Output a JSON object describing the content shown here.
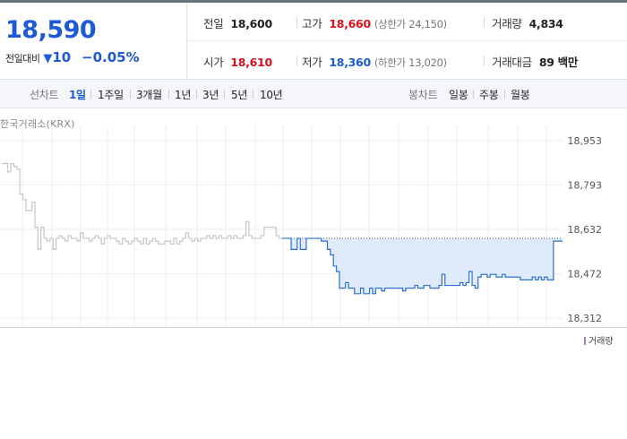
{
  "price": {
    "current": "18,590",
    "diff_label": "전일대비",
    "diff_arrow": "▼",
    "diff_value": "10",
    "diff_pct": "−0.05%"
  },
  "info": {
    "prev_close": {
      "label": "전일",
      "value": "18,600"
    },
    "high": {
      "label": "고가",
      "value": "18,660",
      "sub": "(상한가 24,150)"
    },
    "volume": {
      "label": "거래량",
      "value": "4,834"
    },
    "open": {
      "label": "시가",
      "value": "18,610"
    },
    "low": {
      "label": "저가",
      "value": "18,360",
      "sub": "(하한가 13,020)"
    },
    "amount": {
      "label": "거래대금",
      "value": "89 백만"
    }
  },
  "toolbar": {
    "line_label": "선차트",
    "periods": [
      "1일",
      "1주일",
      "3개월",
      "1년",
      "3년",
      "5년",
      "10년"
    ],
    "active_period": "1일",
    "candle_label": "봉차트",
    "candles": [
      "일봉",
      "주봉",
      "월봉"
    ]
  },
  "source": "한국거래소(KRX)",
  "volume_legend": "거래량",
  "colors": {
    "accent_blue": "#1d5ad6",
    "up_red": "#d6121c",
    "area_fill": "#dfeafb",
    "premarket_gray": "#c9c9c9"
  },
  "chart_data": {
    "type": "line",
    "ylim": [
      18312,
      18953
    ],
    "yticks": [
      "18,953",
      "18,793",
      "18,632",
      "18,472",
      "18,312"
    ],
    "ytick_values": [
      18953,
      18793,
      18632,
      18472,
      18312
    ],
    "baseline": 18600,
    "series": [
      {
        "values": [
          18870,
          18870,
          18840,
          18870,
          18860,
          18850,
          18760,
          18740,
          18700,
          18700,
          18730,
          18640,
          18560,
          18640,
          18600,
          18590,
          18600,
          18560,
          18600,
          18610,
          18600,
          18590,
          18610,
          18600,
          18600,
          18590,
          18620,
          18600,
          18600,
          18590,
          18600,
          18610,
          18600,
          18580,
          18600,
          18610,
          18600,
          18600,
          18590,
          18580,
          18600,
          18590,
          18580,
          18590,
          18600,
          18590,
          18580,
          18600,
          18580,
          18590,
          18600,
          18590,
          18580,
          18580,
          18590,
          18590,
          18580,
          18600,
          18580,
          18590,
          18600,
          18620,
          18600,
          18590,
          18600,
          18590,
          18600,
          18600,
          18610,
          18600,
          18610,
          18600,
          18610,
          18600,
          18600,
          18610,
          18600,
          18610,
          18600,
          18600,
          18610,
          18660,
          18610,
          18600,
          18600,
          18600,
          18610,
          18640,
          18640,
          18640,
          18640,
          18610,
          18600,
          18600,
          18600,
          18600,
          18560,
          18560,
          18600,
          18560,
          18560,
          18600,
          18600,
          18600,
          18600,
          18600,
          18590,
          18590,
          18560,
          18540,
          18500,
          18480,
          18420,
          18420,
          18440,
          18420,
          18420,
          18400,
          18400,
          18420,
          18400,
          18400,
          18420,
          18400,
          18420,
          18420,
          18410,
          18420,
          18420,
          18420,
          18420,
          18420,
          18420,
          18410,
          18420,
          18420,
          18420,
          18430,
          18420,
          18420,
          18430,
          18430,
          18420,
          18420,
          18420,
          18430,
          18470,
          18430,
          18430,
          18430,
          18430,
          18430,
          18440,
          18430,
          18440,
          18480,
          18430,
          18420,
          18460,
          18470,
          18470,
          18460,
          18470,
          18470,
          18460,
          18460,
          18470,
          18460,
          18460,
          18460,
          18460,
          18460,
          18450,
          18450,
          18450,
          18450,
          18460,
          18450,
          18460,
          18450,
          18460,
          18450,
          18450,
          18590,
          18590,
          18590,
          18590
        ]
      }
    ]
  }
}
